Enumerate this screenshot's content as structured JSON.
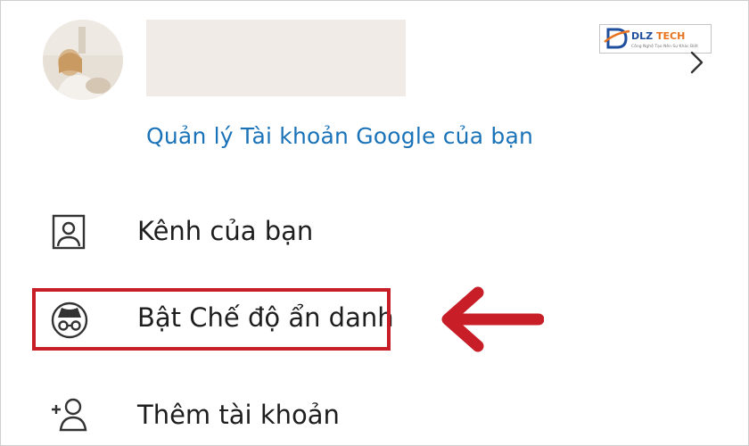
{
  "account": {
    "avatar_icon": "profile-photo",
    "manage_link": "Quản lý Tài khoản Google của bạn",
    "chevron_icon": "chevron-right-icon"
  },
  "watermark": {
    "brand": "DLZ TECH",
    "tagline": "Công Nghệ Tạo Nên Sự Khác Biệt"
  },
  "menu": {
    "items": [
      {
        "label": "Kênh của bạn",
        "icon": "person-box-icon"
      },
      {
        "label": "Bật Chế độ ẩn danh",
        "icon": "incognito-icon",
        "highlighted": true
      },
      {
        "label": "Thêm tài khoản",
        "icon": "add-account-icon"
      }
    ]
  },
  "colors": {
    "link": "#1a73b8",
    "highlight": "#c81e27",
    "text": "#1e1e1e"
  }
}
